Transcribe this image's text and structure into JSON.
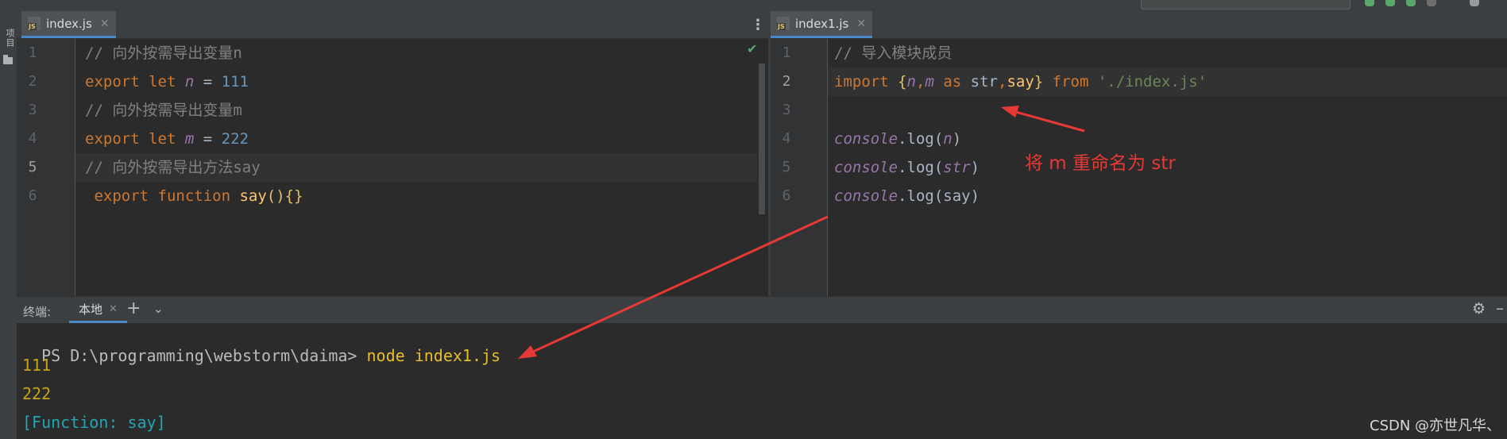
{
  "left_stripe": {
    "project_label": "项目"
  },
  "left_editor": {
    "tab": {
      "filename": "index.js",
      "icon_text": "JS"
    },
    "lines": [
      {
        "number": "1",
        "parts": [
          {
            "t": "// 向外按需导出变量n",
            "c": "cmt"
          }
        ]
      },
      {
        "number": "2",
        "parts": [
          {
            "t": "export let ",
            "c": "kw"
          },
          {
            "t": "n",
            "c": "var-it"
          },
          {
            "t": " = ",
            "c": "plain"
          },
          {
            "t": "111",
            "c": "num"
          }
        ]
      },
      {
        "number": "3",
        "parts": [
          {
            "t": "// 向外按需导出变量m",
            "c": "cmt"
          }
        ]
      },
      {
        "number": "4",
        "parts": [
          {
            "t": "export let ",
            "c": "kw"
          },
          {
            "t": "m",
            "c": "var-it"
          },
          {
            "t": " = ",
            "c": "plain"
          },
          {
            "t": "222",
            "c": "num"
          }
        ]
      },
      {
        "number": "5",
        "parts": [
          {
            "t": "// 向外按需导出方法say",
            "c": "cmt"
          }
        ]
      },
      {
        "number": "6",
        "parts": [
          {
            "t": " export function ",
            "c": "kw"
          },
          {
            "t": "say",
            "c": "fn"
          },
          {
            "t": "(){}",
            "c": "brace"
          }
        ]
      }
    ],
    "current_line": 5
  },
  "right_editor": {
    "tab": {
      "filename": "index1.js",
      "icon_text": "JS"
    },
    "lines": [
      {
        "number": "1",
        "parts": [
          {
            "t": "// 导入模块成员",
            "c": "cmt"
          }
        ]
      },
      {
        "number": "2",
        "parts": [
          {
            "t": "import ",
            "c": "kw"
          },
          {
            "t": "{",
            "c": "brace"
          },
          {
            "t": "n",
            "c": "var-it"
          },
          {
            "t": ",",
            "c": "kw"
          },
          {
            "t": "m",
            "c": "var-it"
          },
          {
            "t": " as ",
            "c": "kw"
          },
          {
            "t": "str",
            "c": "plain"
          },
          {
            "t": ",",
            "c": "kw"
          },
          {
            "t": "say",
            "c": "fn"
          },
          {
            "t": "}",
            "c": "brace"
          },
          {
            "t": " from ",
            "c": "kw"
          },
          {
            "t": "'./index.js'",
            "c": "str"
          }
        ]
      },
      {
        "number": "3",
        "parts": []
      },
      {
        "number": "4",
        "parts": [
          {
            "t": "console",
            "c": "var-it"
          },
          {
            "t": ".log(",
            "c": "plain"
          },
          {
            "t": "n",
            "c": "var-it"
          },
          {
            "t": ")",
            "c": "plain"
          }
        ]
      },
      {
        "number": "5",
        "parts": [
          {
            "t": "console",
            "c": "var-it"
          },
          {
            "t": ".log(",
            "c": "plain"
          },
          {
            "t": "str",
            "c": "var-it"
          },
          {
            "t": ")",
            "c": "plain"
          }
        ]
      },
      {
        "number": "6",
        "parts": [
          {
            "t": "console",
            "c": "var-it"
          },
          {
            "t": ".log(say)",
            "c": "plain"
          }
        ]
      }
    ],
    "current_line": 2
  },
  "annotation": {
    "text": "将 m 重命名为 str",
    "color": "#e53935"
  },
  "terminal": {
    "label": "终端:",
    "tab_label": "本地",
    "prompt": "PS D:\\programming\\webstorm\\daima> ",
    "command": "node index1.js",
    "output": [
      {
        "text": "111",
        "color": "#c8a415"
      },
      {
        "text": "222",
        "color": "#c8a415"
      },
      {
        "text": "[Function: say]",
        "color": "#21a7b3"
      }
    ]
  },
  "watermark": "CSDN @亦世凡华、",
  "colors": {
    "accent_tab": "#4a88c7",
    "keyword": "#cc7832",
    "number": "#6897bb",
    "comment": "#808080",
    "background": "#2b2b2b"
  }
}
